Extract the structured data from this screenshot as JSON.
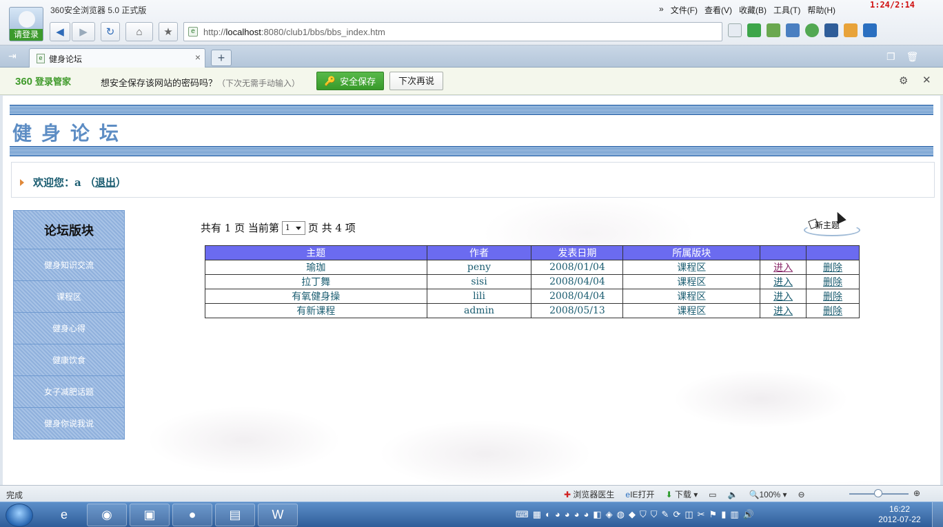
{
  "browser": {
    "title": "360安全浏览器 5.0 正式版",
    "login_label": "请登录",
    "menu": [
      "文件(F)",
      "查看(V)",
      "收藏(B)",
      "工具(T)",
      "帮助(H)"
    ],
    "clock_overlay": "1:24/2:14",
    "url_prefix": "http://",
    "url_host": "localhost",
    "url_rest": ":8080/club1/bbs/bbs_index.htm",
    "tab_label": "健身论坛",
    "tab_close": "×",
    "new_tab": "+"
  },
  "password_bar": {
    "brand": "360",
    "brand_sub": "登录管家",
    "question": "想安全保存该网站的密码吗？",
    "hint": "（下次无需手动输入）",
    "save_label": "安全保存",
    "later_label": "下次再说"
  },
  "page": {
    "forum_title": "健身论坛",
    "welcome_prefix": "欢迎您：a （",
    "logout_label": "退出",
    "welcome_suffix": "）",
    "sidebar_title": "论坛版块",
    "sidebar_items": [
      "健身知识交流",
      "课程区",
      "健身心得",
      "健康饮食",
      "女子减肥话题",
      "健身你说我说"
    ],
    "pager": {
      "total_pages_text": "共有 1 页 当前第",
      "selected_page": "1",
      "after_select_text": "页 共 4 项"
    },
    "new_topic_label": "新主题",
    "table": {
      "headers": [
        "主题",
        "作者",
        "发表日期",
        "所属版块",
        "",
        ""
      ],
      "rows": [
        {
          "topic": "瑜珈",
          "author": "peny",
          "date": "2008/01/04",
          "board": "课程区",
          "enter": "进入",
          "delete": "删除"
        },
        {
          "topic": "拉丁舞",
          "author": "sisi",
          "date": "2008/04/04",
          "board": "课程区",
          "enter": "进入",
          "delete": "删除"
        },
        {
          "topic": "有氧健身操",
          "author": "lili",
          "date": "2008/04/04",
          "board": "课程区",
          "enter": "进入",
          "delete": "删除"
        },
        {
          "topic": "有新课程",
          "author": "admin",
          "date": "2008/05/13",
          "board": "课程区",
          "enter": "进入",
          "delete": "删除"
        }
      ]
    }
  },
  "statusbar": {
    "status": "完成",
    "doctor": "浏览器医生",
    "ie_open": "IE打开",
    "download": "下载",
    "zoom": "100%"
  },
  "taskbar": {
    "time": "16:22",
    "date": "2012-07-22"
  },
  "colors": {
    "table_header": "#6b6bf0",
    "sidebar": "#8fb0dc",
    "title_blue": "#5d8dc4",
    "save_green": "#3f9a2a"
  }
}
